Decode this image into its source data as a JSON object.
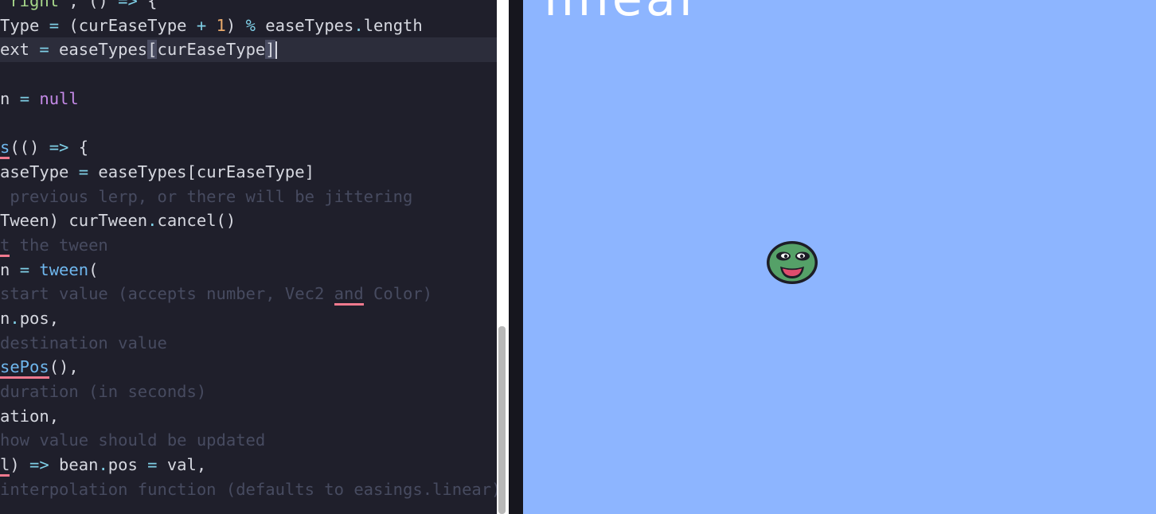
{
  "editor": {
    "lines": [
      {
        "segments": [
          {
            "t": "\"right\", () => {",
            "c": "tok-str-mix"
          }
        ]
      },
      {
        "text_a": "Type = (curEaseType + 1) % easeTypes.length"
      },
      {
        "text_a": "ext = easeTypes[curEaseType]"
      },
      {
        "text_a": ""
      },
      {
        "text_a": "n = null"
      },
      {
        "text_a": ""
      },
      {
        "text_a": "s(() => {"
      },
      {
        "text_a": "aseType = easeTypes[curEaseType]"
      },
      {
        "text_a": " previous lerp, or there will be jittering"
      },
      {
        "text_a": "Tween) curTween.cancel()"
      },
      {
        "text_a": "t the tween"
      },
      {
        "text_a": "n = tween("
      },
      {
        "text_a": "start value (accepts number, Vec2 and Color)"
      },
      {
        "text_a": "n.pos,"
      },
      {
        "text_a": "destination value"
      },
      {
        "text_a": "sePos(),"
      },
      {
        "text_a": "duration (in seconds)"
      },
      {
        "text_a": "ation,"
      },
      {
        "text_a": "how value should be updated"
      },
      {
        "text_a": "l) => bean.pos = val,"
      },
      {
        "text_a": "interpolation function (defaults to easings.linear)"
      }
    ]
  },
  "canvas": {
    "ease_label": "linear",
    "bg_color": "#8db5ff"
  },
  "colors": {
    "editor_bg": "#1f1f2b",
    "string": "#a8d88b",
    "operator": "#7fcfe6",
    "number": "#e8a96b",
    "keyword": "#c58ae8",
    "function": "#6fb7ee",
    "comment": "#474b60",
    "error_underline": "#f0798e"
  },
  "icons": {
    "bean": "bean-sprite-icon"
  }
}
